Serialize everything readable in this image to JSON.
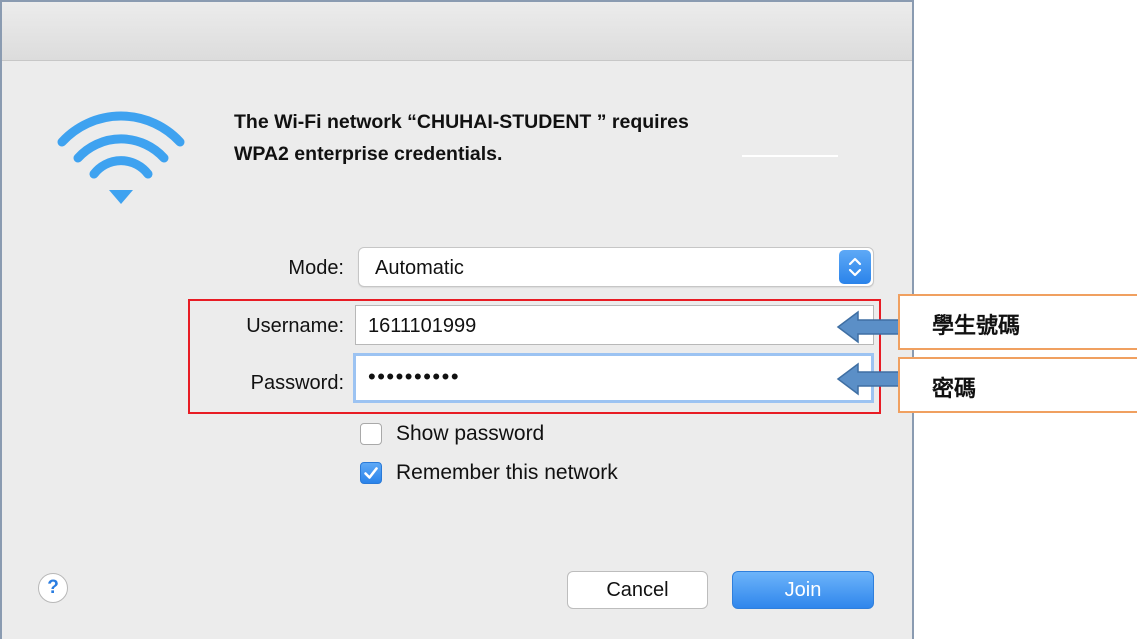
{
  "dialog": {
    "heading_line1": "The Wi-Fi network “CHUHAI-STUDENT ” requires",
    "heading_line2": "WPA2 enterprise credentials.",
    "accent_color": "#2a83ea"
  },
  "form": {
    "mode_label": "Mode:",
    "mode_value": "Automatic",
    "username_label": "Username:",
    "username_value": "1611101999",
    "password_label": "Password:",
    "password_masked": "••••••••••",
    "show_password_label": "Show password",
    "show_password_checked": false,
    "remember_label": "Remember this network",
    "remember_checked": true
  },
  "buttons": {
    "help": "?",
    "cancel": "Cancel",
    "join": "Join"
  },
  "annotations": {
    "username_note": "學生號碼",
    "password_note": "密碼",
    "highlight_color": "#e81c24",
    "callout_color": "#f0a060",
    "arrow_color": "#5b8fc7"
  }
}
